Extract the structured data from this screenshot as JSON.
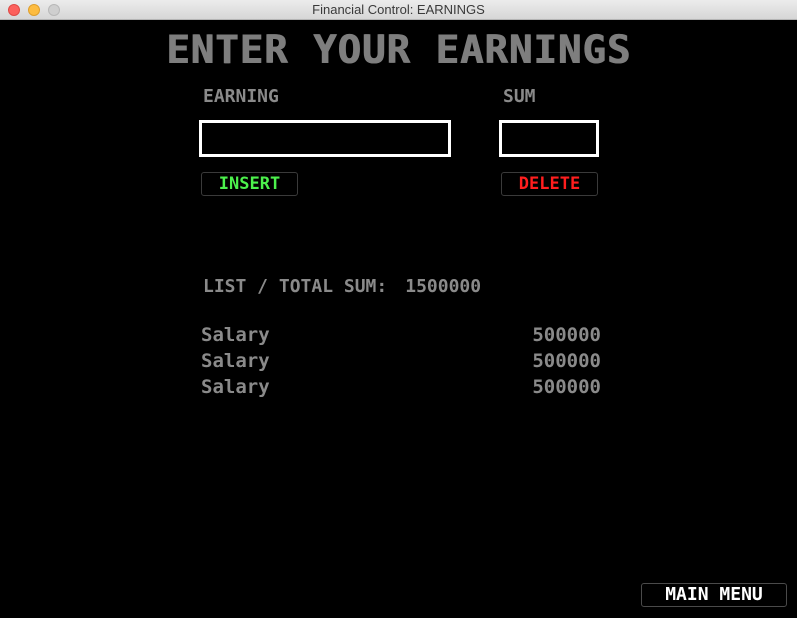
{
  "window": {
    "title": "Financial Control: EARNINGS"
  },
  "page": {
    "heading": "ENTER YOUR EARNINGS"
  },
  "form": {
    "earning_label": "EARNING",
    "sum_label": "SUM",
    "earning_value": "",
    "sum_value": "",
    "insert_label": "INSERT",
    "delete_label": "DELETE"
  },
  "list": {
    "header_label": "LIST / TOTAL SUM:",
    "total": "1500000",
    "items": [
      {
        "name": "Salary",
        "amount": "500000"
      },
      {
        "name": "Salary",
        "amount": "500000"
      },
      {
        "name": "Salary",
        "amount": "500000"
      }
    ]
  },
  "nav": {
    "main_menu_label": "MAIN MENU"
  },
  "colors": {
    "background": "#000000",
    "text": "#8a8a8a",
    "insert": "#4cf04c",
    "delete": "#ff1e1e",
    "field_border": "#ffffff"
  }
}
